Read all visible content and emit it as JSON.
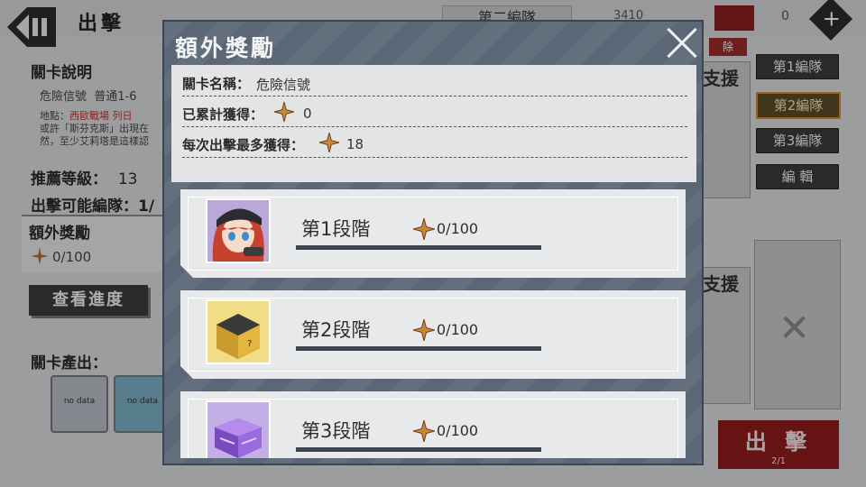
{
  "background": {
    "screen_title": "出擊",
    "team_tab": "第二編隊",
    "counter": "3410",
    "zero": "0",
    "level_info_heading": "關卡說明",
    "stage_name": "危險信號",
    "stage_code": "普通1-6",
    "location_label": "地點：",
    "location_value": "西歐戰場 列日",
    "desc_line1": "或許「斯芬克斯」出現在",
    "desc_line2": "然，至少艾莉塔是這樣認",
    "recommend_level_label": "推薦等級：",
    "recommend_level_value": "13",
    "team_count_label": "出擊可能編隊：1/",
    "extra_reward_label": "額外獎勵",
    "extra_reward_value": "0/100",
    "view_progress_button": "查看進度",
    "stage_drops_label": "關卡產出：",
    "drops": [
      "no data",
      "no data"
    ],
    "team_buttons": [
      "第1編隊",
      "第2編隊",
      "第3編隊",
      "編 輯"
    ],
    "selected_team": 1,
    "support_label": "支援",
    "red_tab": "除",
    "sortie_button": "出 擊",
    "sortie_count": "2/1"
  },
  "modal": {
    "title": "額外獎勵",
    "stage_name_label": "關卡名稱：",
    "stage_name_value": "危險信號",
    "accumulated_label": "已累計獲得：",
    "accumulated_value": "0",
    "max_per_sortie_label": "每次出擊最多獲得：",
    "max_per_sortie_value": "18",
    "tiers": [
      {
        "name": "第1段階",
        "progress_text": "0/100",
        "progress": 0,
        "icon": "character-portrait-icon"
      },
      {
        "name": "第2段階",
        "progress_text": "0/100",
        "progress": 0,
        "icon": "gold-crate-icon"
      },
      {
        "name": "第3段階",
        "progress_text": "0/100",
        "progress": 0,
        "icon": "purple-crate-icon"
      }
    ]
  },
  "colors": {
    "modal_bg": "#5b6776",
    "star": "#c9893a",
    "sortie_red": "#8c1b1b",
    "selected_team_border": "#d88a2a"
  }
}
